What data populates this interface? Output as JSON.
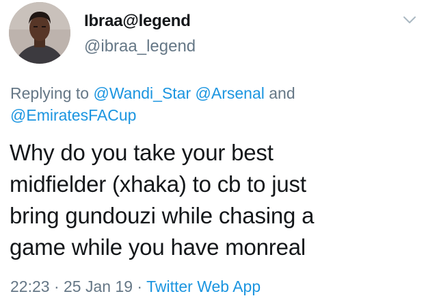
{
  "tweet": {
    "display_name": "Ibraa@legend",
    "handle": "@ibraa_legend",
    "replying_prefix": "Replying to ",
    "reply_mention_1": "@Wandi_Star",
    "reply_mention_2": "@Arsenal",
    "reply_conjunction": " and ",
    "reply_mention_3": "@EmiratesFACup",
    "text": "Why do you take your best\nmidfielder (xhaka) to cb to just\nbring gundouzi while chasing a\ngame while you have monreal",
    "time": "22:23",
    "separator": " · ",
    "date": "25 Jan 19",
    "source": "Twitter Web App"
  },
  "icons": {
    "more": "chevron-down-icon",
    "avatar": "avatar"
  },
  "colors": {
    "primary_text": "#14171a",
    "secondary_text": "#657786",
    "link": "#1b95e0",
    "background": "#ffffff"
  }
}
